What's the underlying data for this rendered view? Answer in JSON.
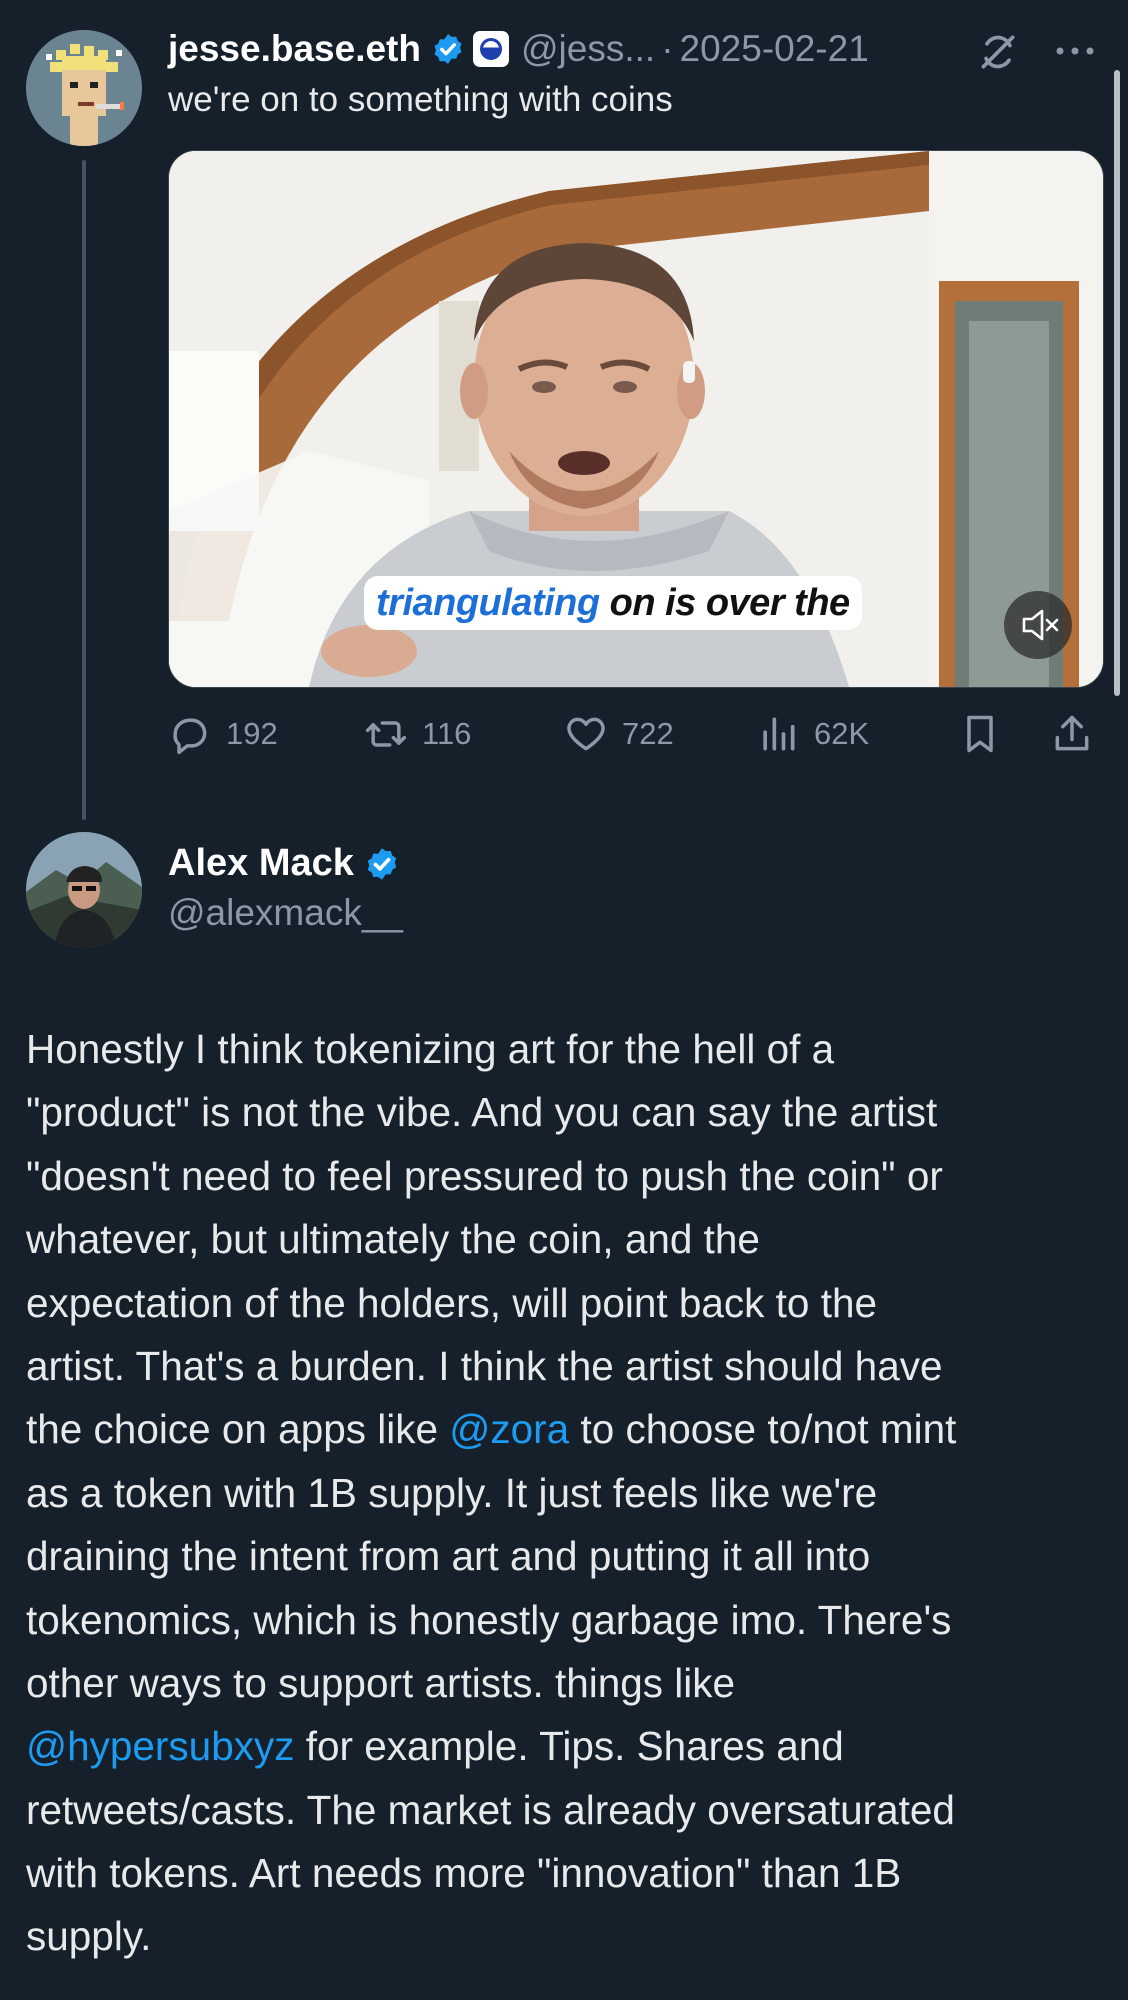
{
  "tweet1": {
    "display_name": "jesse.base.eth",
    "handle": "@jess...",
    "date": "2025-02-21",
    "separator": "·",
    "text": "we're on to something with coins",
    "video_caption_highlight": "triangulating",
    "video_caption_rest": "on is over the",
    "actions": {
      "replies": "192",
      "reposts": "116",
      "likes": "722",
      "views": "62K"
    },
    "icons": [
      "verified-badge-icon",
      "base-badge-icon",
      "sync-off-icon",
      "more-icon",
      "mute-icon",
      "reply-icon",
      "repost-icon",
      "like-icon",
      "views-icon",
      "bookmark-icon",
      "share-icon"
    ]
  },
  "tweet2": {
    "display_name": "Alex Mack",
    "handle": "@alexmack__",
    "lines": [
      [
        {
          "t": "Honestly I think tokenizing art for the hell of a"
        }
      ],
      [
        {
          "t": "\"product\" is not the vibe. And you can say the artist"
        }
      ],
      [
        {
          "t": "\"doesn't need to feel pressured to push the coin\" or"
        }
      ],
      [
        {
          "t": "whatever, but ultimately the coin, and the"
        }
      ],
      [
        {
          "t": "expectation of the holders, will point back to the"
        }
      ],
      [
        {
          "t": "artist. That's a burden. I think the artist should have"
        }
      ],
      [
        {
          "t": "the choice on apps like "
        },
        {
          "t": "@zora",
          "mention": true
        },
        {
          "t": " to choose to/not mint"
        }
      ],
      [
        {
          "t": "as a token with 1B supply. It just feels like we're"
        }
      ],
      [
        {
          "t": "draining the intent from art and putting it all into"
        }
      ],
      [
        {
          "t": "tokenomics, which is honestly garbage imo. There's"
        }
      ],
      [
        {
          "t": "other ways to support artists. things like"
        }
      ],
      [
        {
          "t": "@hypersubxyz",
          "mention": true
        },
        {
          "t": " for example. Tips. Shares and"
        }
      ],
      [
        {
          "t": "retweets/casts. The market is already oversaturated"
        }
      ],
      [
        {
          "t": "with tokens. Art needs more \"innovation\" than 1B"
        }
      ],
      [
        {
          "t": "supply."
        }
      ]
    ]
  },
  "colors": {
    "background": "#15202b",
    "text": "#e7e9ea",
    "secondary": "#8b98a5",
    "mention": "#1d9bf0",
    "verified": "#1d9bf0"
  }
}
